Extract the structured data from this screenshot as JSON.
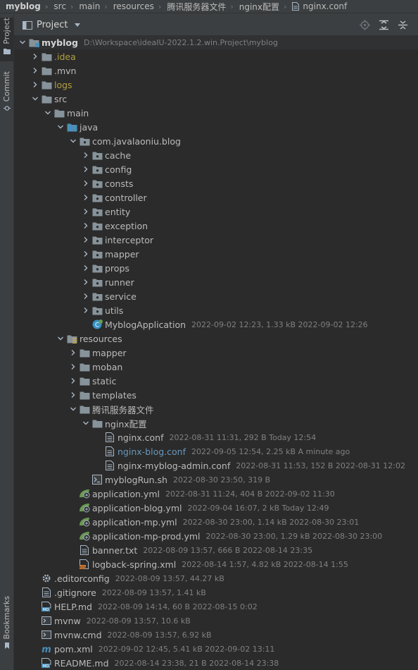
{
  "breadcrumbs": [
    "myblog",
    "src",
    "main",
    "resources",
    "腾讯服务器文件",
    "nginx配置",
    "nginx.conf"
  ],
  "left_strip": {
    "project": "Project",
    "commit": "Commit",
    "bookmarks": "Bookmarks"
  },
  "panel": {
    "title": "Project"
  },
  "colors": {
    "folder": "#87939a",
    "src_folder": "#4a8fb8",
    "yellow": "#b0a040",
    "blue": "#6897bb"
  },
  "tree": [
    {
      "depth": 0,
      "chevron": "down",
      "icon": "module-folder",
      "label": "myblog",
      "style": "bold",
      "meta": "D:\\Workspace\\ideaIU-2022.1.2.win.Project\\myblog"
    },
    {
      "depth": 1,
      "chevron": "right",
      "icon": "folder",
      "label": ".idea",
      "style": "yellow",
      "meta": ""
    },
    {
      "depth": 1,
      "chevron": "right",
      "icon": "folder",
      "label": ".mvn",
      "style": "",
      "meta": ""
    },
    {
      "depth": 1,
      "chevron": "right",
      "icon": "folder",
      "label": "logs",
      "style": "yellow",
      "meta": ""
    },
    {
      "depth": 1,
      "chevron": "down",
      "icon": "folder",
      "label": "src",
      "style": "",
      "meta": ""
    },
    {
      "depth": 2,
      "chevron": "down",
      "icon": "folder",
      "label": "main",
      "style": "",
      "meta": ""
    },
    {
      "depth": 3,
      "chevron": "down",
      "icon": "src-folder",
      "label": "java",
      "style": "",
      "meta": ""
    },
    {
      "depth": 4,
      "chevron": "down",
      "icon": "package",
      "label": "com.javalaoniu.blog",
      "style": "",
      "meta": ""
    },
    {
      "depth": 5,
      "chevron": "right",
      "icon": "package",
      "label": "cache",
      "style": "",
      "meta": ""
    },
    {
      "depth": 5,
      "chevron": "right",
      "icon": "package",
      "label": "config",
      "style": "",
      "meta": ""
    },
    {
      "depth": 5,
      "chevron": "right",
      "icon": "package",
      "label": "consts",
      "style": "",
      "meta": ""
    },
    {
      "depth": 5,
      "chevron": "right",
      "icon": "package",
      "label": "controller",
      "style": "",
      "meta": ""
    },
    {
      "depth": 5,
      "chevron": "right",
      "icon": "package",
      "label": "entity",
      "style": "",
      "meta": ""
    },
    {
      "depth": 5,
      "chevron": "right",
      "icon": "package",
      "label": "exception",
      "style": "",
      "meta": ""
    },
    {
      "depth": 5,
      "chevron": "right",
      "icon": "package",
      "label": "interceptor",
      "style": "",
      "meta": ""
    },
    {
      "depth": 5,
      "chevron": "right",
      "icon": "package",
      "label": "mapper",
      "style": "",
      "meta": ""
    },
    {
      "depth": 5,
      "chevron": "right",
      "icon": "package",
      "label": "props",
      "style": "",
      "meta": ""
    },
    {
      "depth": 5,
      "chevron": "right",
      "icon": "package",
      "label": "runner",
      "style": "",
      "meta": ""
    },
    {
      "depth": 5,
      "chevron": "right",
      "icon": "package",
      "label": "service",
      "style": "",
      "meta": ""
    },
    {
      "depth": 5,
      "chevron": "right",
      "icon": "package",
      "label": "utils",
      "style": "",
      "meta": ""
    },
    {
      "depth": 5,
      "chevron": "none",
      "icon": "spring-class",
      "label": "MyblogApplication",
      "style": "",
      "meta": "2022-09-02 12:23, 1.33 kB 2022-09-02 12:26"
    },
    {
      "depth": 3,
      "chevron": "down",
      "icon": "resources-folder",
      "label": "resources",
      "style": "",
      "meta": ""
    },
    {
      "depth": 4,
      "chevron": "right",
      "icon": "folder",
      "label": "mapper",
      "style": "",
      "meta": ""
    },
    {
      "depth": 4,
      "chevron": "right",
      "icon": "folder",
      "label": "moban",
      "style": "",
      "meta": ""
    },
    {
      "depth": 4,
      "chevron": "right",
      "icon": "folder",
      "label": "static",
      "style": "",
      "meta": ""
    },
    {
      "depth": 4,
      "chevron": "right",
      "icon": "folder",
      "label": "templates",
      "style": "",
      "meta": ""
    },
    {
      "depth": 4,
      "chevron": "down",
      "icon": "folder",
      "label": "腾讯服务器文件",
      "style": "",
      "meta": ""
    },
    {
      "depth": 5,
      "chevron": "down",
      "icon": "folder",
      "label": "nginx配置",
      "style": "",
      "meta": ""
    },
    {
      "depth": 6,
      "chevron": "none",
      "icon": "text-file",
      "label": "nginx.conf",
      "style": "",
      "meta": "2022-08-31 11:31, 292 B Today 12:54"
    },
    {
      "depth": 6,
      "chevron": "none",
      "icon": "text-file",
      "label": "nginx-blog.conf",
      "style": "blue",
      "meta": "2022-09-05 12:54, 2.25 kB A minute ago"
    },
    {
      "depth": 6,
      "chevron": "none",
      "icon": "text-file",
      "label": "nginx-myblog-admin.conf",
      "style": "",
      "meta": "2022-08-31 11:53, 152 B 2022-08-31 12:02"
    },
    {
      "depth": 5,
      "chevron": "none",
      "icon": "shell-file",
      "label": "myblogRun.sh",
      "style": "",
      "meta": "2022-08-30 23:50, 319 B"
    },
    {
      "depth": 4,
      "chevron": "none",
      "icon": "spring-yml",
      "label": "application.yml",
      "style": "",
      "meta": "2022-08-31 11:24, 404 B 2022-09-02 11:30"
    },
    {
      "depth": 4,
      "chevron": "none",
      "icon": "spring-yml",
      "label": "application-blog.yml",
      "style": "",
      "meta": "2022-09-04 16:07, 2 kB Today 12:49"
    },
    {
      "depth": 4,
      "chevron": "none",
      "icon": "spring-yml",
      "label": "application-mp.yml",
      "style": "",
      "meta": "2022-08-30 23:00, 1.14 kB 2022-08-30 23:01"
    },
    {
      "depth": 4,
      "chevron": "none",
      "icon": "spring-yml",
      "label": "application-mp-prod.yml",
      "style": "",
      "meta": "2022-08-30 23:00, 1.29 kB 2022-08-30 23:00"
    },
    {
      "depth": 4,
      "chevron": "none",
      "icon": "text-file",
      "label": "banner.txt",
      "style": "",
      "meta": "2022-08-09 13:57, 666 B 2022-08-14 23:35"
    },
    {
      "depth": 4,
      "chevron": "none",
      "icon": "xml-file",
      "label": "logback-spring.xml",
      "style": "",
      "meta": "2022-08-14 1:57, 4.82 kB 2022-08-14 1:55"
    },
    {
      "depth": 1,
      "chevron": "none",
      "icon": "gear-file",
      "label": ".editorconfig",
      "style": "",
      "meta": "2022-08-09 13:57, 44.27 kB"
    },
    {
      "depth": 1,
      "chevron": "none",
      "icon": "text-file",
      "label": ".gitignore",
      "style": "",
      "meta": "2022-08-09 13:57, 1.41 kB"
    },
    {
      "depth": 1,
      "chevron": "none",
      "icon": "md-file",
      "label": "HELP.md",
      "style": "",
      "meta": "2022-08-09 14:14, 60 B 2022-08-15 0:02"
    },
    {
      "depth": 1,
      "chevron": "none",
      "icon": "exec-file",
      "label": "mvnw",
      "style": "",
      "meta": "2022-08-09 13:57, 10.6 kB"
    },
    {
      "depth": 1,
      "chevron": "none",
      "icon": "exec-file",
      "label": "mvnw.cmd",
      "style": "",
      "meta": "2022-08-09 13:57, 6.92 kB"
    },
    {
      "depth": 1,
      "chevron": "none",
      "icon": "maven-file",
      "label": "pom.xml",
      "style": "",
      "meta": "2022-09-02 12:45, 5.41 kB 2022-09-02 13:11"
    },
    {
      "depth": 1,
      "chevron": "none",
      "icon": "md-file",
      "label": "README.md",
      "style": "",
      "meta": "2022-08-14 23:38, 21 B 2022-08-14 23:38"
    }
  ]
}
